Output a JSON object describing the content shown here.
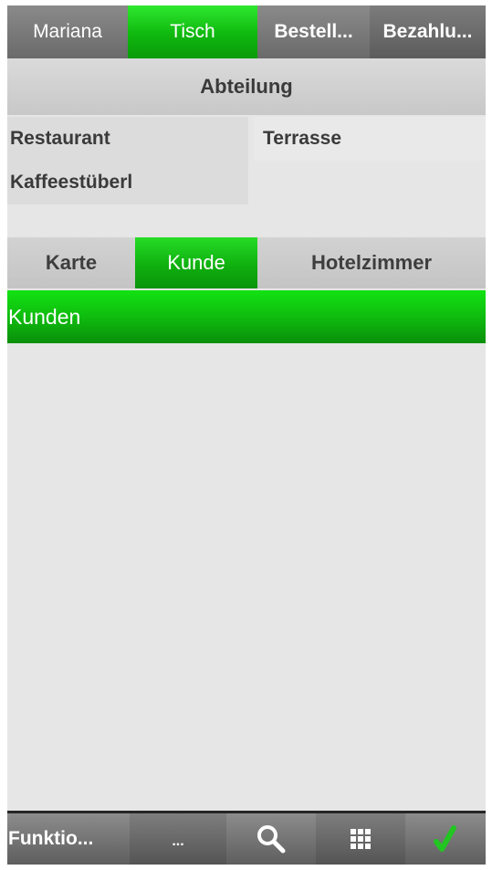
{
  "top_tabs": [
    {
      "label": "Mariana"
    },
    {
      "label": "Tisch"
    },
    {
      "label": "Bestell..."
    },
    {
      "label": "Bezahlu..."
    }
  ],
  "department": {
    "header": "Abteilung",
    "items": [
      {
        "label": "Restaurant"
      },
      {
        "label": "Terrasse"
      },
      {
        "label": "Kaffeestüberl"
      }
    ]
  },
  "middle_tabs": [
    {
      "label": "Karte"
    },
    {
      "label": "Kunde"
    },
    {
      "label": "Hotelzimmer"
    }
  ],
  "list": {
    "header": "Kunden"
  },
  "toolbar": {
    "functions_label": "Funktio...",
    "more_label": "...",
    "search_icon": "search-icon",
    "grid_icon": "grid-icon",
    "confirm_icon": "checkmark-icon"
  },
  "colors": {
    "active_green": "#0fb80f",
    "confirm_green": "#22c522",
    "tab_gray": "#6a6a6a",
    "background": "#e6e6e6"
  }
}
